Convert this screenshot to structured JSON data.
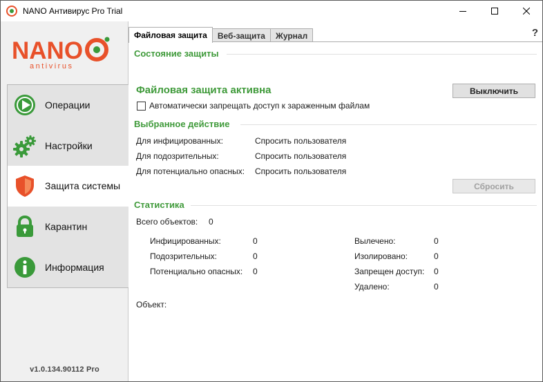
{
  "window": {
    "title": "NANO Антивирус Pro Trial"
  },
  "sidebar": {
    "logo_word": "NANO",
    "logo_sub": "antivirus",
    "items": [
      {
        "label": "Операции",
        "icon": "play-icon"
      },
      {
        "label": "Настройки",
        "icon": "gears-icon"
      },
      {
        "label": "Защита системы",
        "icon": "shield-icon"
      },
      {
        "label": "Карантин",
        "icon": "lock-icon"
      },
      {
        "label": "Информация",
        "icon": "info-icon"
      }
    ],
    "active_index": 2,
    "version": "v1.0.134.90112 Pro"
  },
  "tabs": [
    {
      "label": "Файловая защита",
      "active": true
    },
    {
      "label": "Веб-защита",
      "active": false
    },
    {
      "label": "Журнал",
      "active": false
    }
  ],
  "help": "?",
  "protection": {
    "section_title": "Состояние защиты",
    "status": "Файловая защита активна",
    "disable_button": "Выключить",
    "auto_block_label": "Автоматически запрещать доступ к зараженным файлам",
    "auto_block_checked": false
  },
  "action": {
    "section_title": "Выбранное действие",
    "rows": [
      {
        "label": "Для инфицированных:",
        "value": "Спросить пользователя"
      },
      {
        "label": "Для подозрительных:",
        "value": "Спросить пользователя"
      },
      {
        "label": "Для потенциально опасных:",
        "value": "Спросить пользователя"
      }
    ],
    "reset_button": "Сбросить"
  },
  "stats": {
    "section_title": "Статистика",
    "total_label": "Всего объектов:",
    "total_value": "0",
    "left": [
      {
        "label": "Инфицированных:",
        "value": "0"
      },
      {
        "label": "Подозрительных:",
        "value": "0"
      },
      {
        "label": "Потенциально опасных:",
        "value": "0"
      }
    ],
    "right": [
      {
        "label": "Вылечено:",
        "value": "0"
      },
      {
        "label": "Изолировано:",
        "value": "0"
      },
      {
        "label": "Запрещен доступ:",
        "value": "0"
      },
      {
        "label": "Удалено:",
        "value": "0"
      }
    ],
    "object_label": "Объект:"
  },
  "colors": {
    "accent_green": "#3f9a3a",
    "logo_orange": "#e8512a",
    "icon_green": "#3a9a3a"
  }
}
